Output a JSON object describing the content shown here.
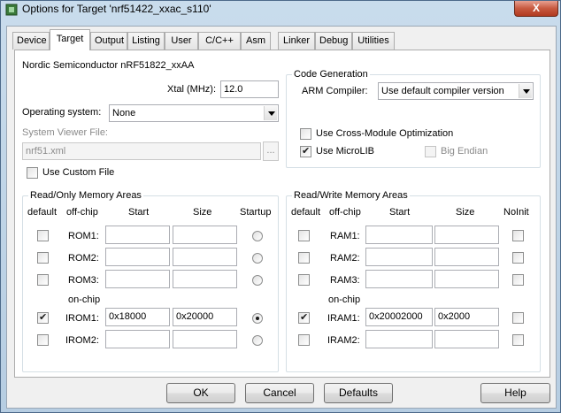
{
  "window": {
    "title": "Options for Target 'nrf51422_xxac_s110'",
    "close_glyph": "X"
  },
  "tabs": [
    "Device",
    "Target",
    "Output",
    "Listing",
    "User",
    "C/C++",
    "Asm",
    "Linker",
    "Debug",
    "Utilities"
  ],
  "active_tab": "Target",
  "device_name": "Nordic Semiconductor nRF51822_xxAA",
  "xtal": {
    "label": "Xtal (MHz):",
    "value": "12.0"
  },
  "os": {
    "label": "Operating system:",
    "value": "None"
  },
  "svd": {
    "label": "System Viewer File:",
    "value": "nrf51.xml",
    "browse": "..."
  },
  "custom_file": {
    "label": "Use Custom File",
    "checked": false
  },
  "codegen": {
    "title": "Code Generation",
    "compiler_label": "ARM Compiler:",
    "compiler_value": "Use default compiler version",
    "cross_module": {
      "label": "Use Cross-Module Optimization",
      "checked": false
    },
    "microlib": {
      "label": "Use MicroLIB",
      "checked": true
    },
    "big_endian": {
      "label": "Big Endian",
      "checked": false,
      "disabled": true
    }
  },
  "rom": {
    "title": "Read/Only Memory Areas",
    "headers": {
      "default": "default",
      "offchip": "off-chip",
      "start": "Start",
      "size": "Size",
      "last": "Startup"
    },
    "onchip_label": "on-chip",
    "rows": [
      {
        "name": "ROM1:",
        "default": false,
        "start": "",
        "size": "",
        "selected": false
      },
      {
        "name": "ROM2:",
        "default": false,
        "start": "",
        "size": "",
        "selected": false
      },
      {
        "name": "ROM3:",
        "default": false,
        "start": "",
        "size": "",
        "selected": false
      },
      {
        "name": "IROM1:",
        "default": true,
        "start": "0x18000",
        "size": "0x20000",
        "selected": true
      },
      {
        "name": "IROM2:",
        "default": false,
        "start": "",
        "size": "",
        "selected": false
      }
    ]
  },
  "ram": {
    "title": "Read/Write Memory Areas",
    "headers": {
      "default": "default",
      "offchip": "off-chip",
      "start": "Start",
      "size": "Size",
      "last": "NoInit"
    },
    "onchip_label": "on-chip",
    "rows": [
      {
        "name": "RAM1:",
        "default": false,
        "start": "",
        "size": "",
        "noinit": false
      },
      {
        "name": "RAM2:",
        "default": false,
        "start": "",
        "size": "",
        "noinit": false
      },
      {
        "name": "RAM3:",
        "default": false,
        "start": "",
        "size": "",
        "noinit": false
      },
      {
        "name": "IRAM1:",
        "default": true,
        "start": "0x20002000",
        "size": "0x2000",
        "noinit": false
      },
      {
        "name": "IRAM2:",
        "default": false,
        "start": "",
        "size": "",
        "noinit": false
      }
    ]
  },
  "buttons": {
    "ok": "OK",
    "cancel": "Cancel",
    "defaults": "Defaults",
    "help": "Help"
  }
}
